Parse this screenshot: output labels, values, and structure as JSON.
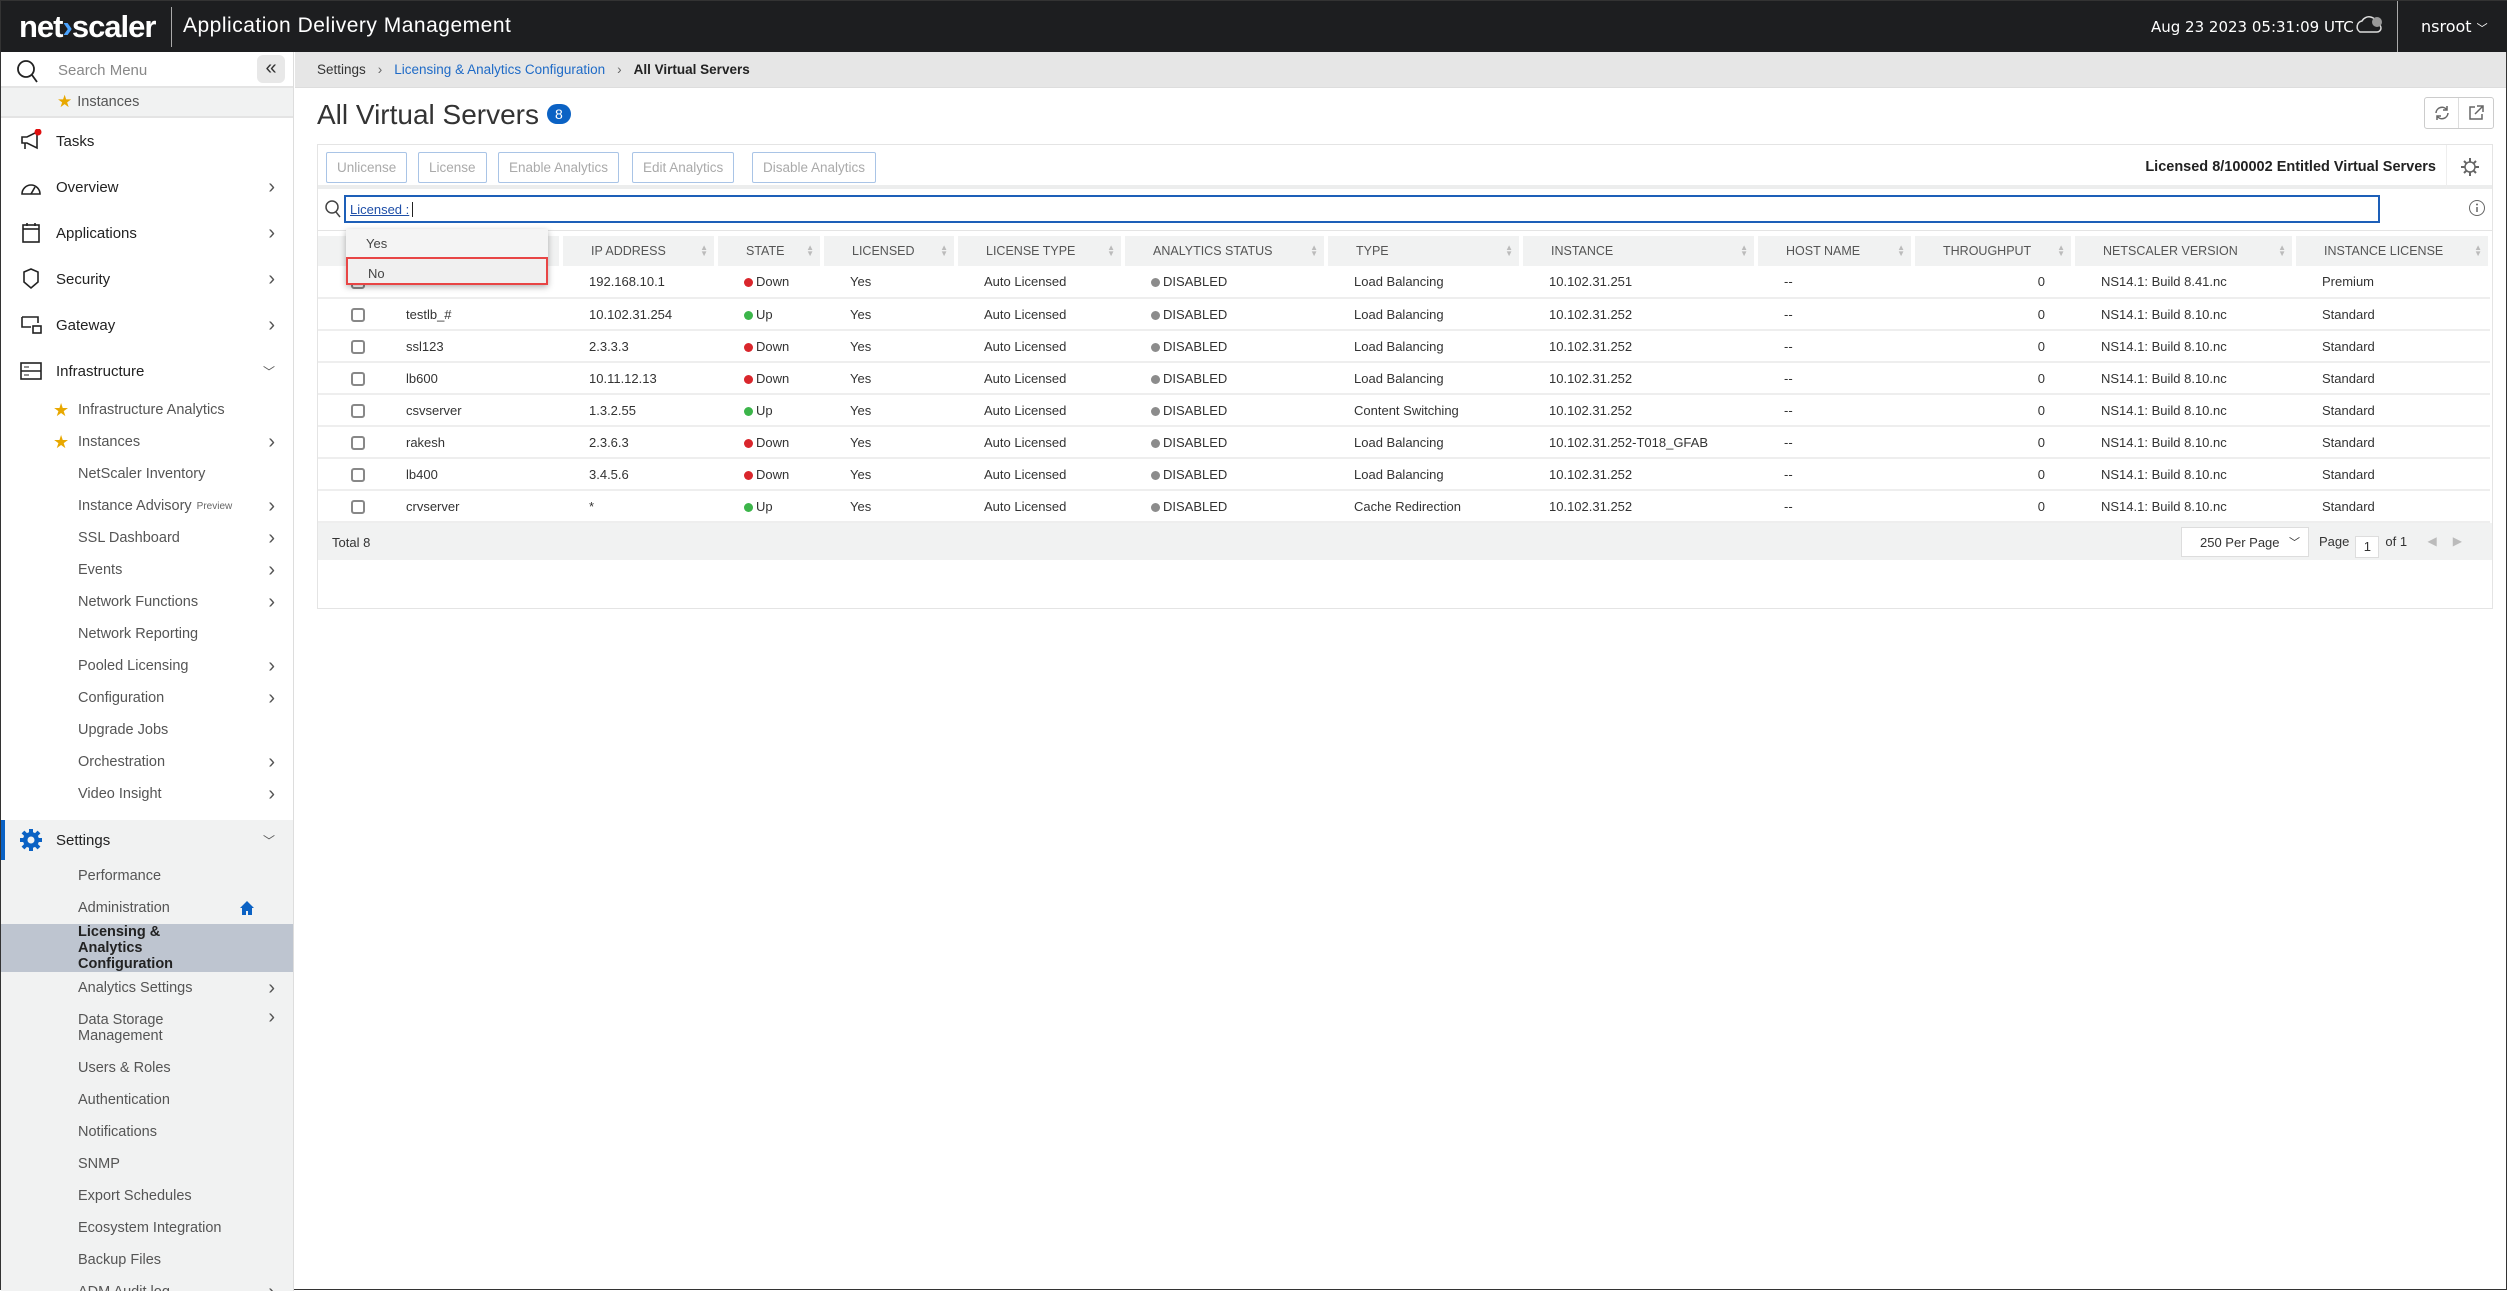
{
  "header": {
    "logo": "netscaler",
    "app_title": "Application Delivery Management",
    "datetime": "Aug 23 2023 05:31:09 UTC",
    "user": "nsroot"
  },
  "sidebar": {
    "search_placeholder": "Search Menu",
    "pinned": "Instances",
    "top_items": [
      {
        "label": "Tasks",
        "icon": "megaphone-icon"
      },
      {
        "label": "Overview",
        "icon": "gauge-icon",
        "chevron": true
      },
      {
        "label": "Applications",
        "icon": "calendar-icon",
        "chevron": true
      },
      {
        "label": "Security",
        "icon": "shield-icon",
        "chevron": true
      },
      {
        "label": "Gateway",
        "icon": "gateway-lock-icon",
        "chevron": true
      },
      {
        "label": "Infrastructure",
        "icon": "server-rack-icon",
        "expanded": true
      }
    ],
    "infra_items": [
      {
        "label": "Infrastructure Analytics",
        "star": true
      },
      {
        "label": "Instances",
        "star": true,
        "chevron": true
      },
      {
        "label": "NetScaler Inventory"
      },
      {
        "label": "Instance Advisory",
        "sup": "Preview",
        "chevron": true
      },
      {
        "label": "SSL Dashboard",
        "chevron": true
      },
      {
        "label": "Events",
        "chevron": true
      },
      {
        "label": "Network Functions",
        "chevron": true
      },
      {
        "label": "Network Reporting"
      },
      {
        "label": "Pooled Licensing",
        "chevron": true
      },
      {
        "label": "Configuration",
        "chevron": true
      },
      {
        "label": "Upgrade Jobs"
      },
      {
        "label": "Orchestration",
        "chevron": true
      },
      {
        "label": "Video Insight",
        "chevron": true
      }
    ],
    "settings": {
      "label": "Settings",
      "items": [
        {
          "label": "Performance"
        },
        {
          "label": "Administration",
          "home": true
        },
        {
          "label": "Licensing & Analytics Configuration",
          "active": true
        },
        {
          "label": "Analytics Settings",
          "chevron": true
        },
        {
          "label": "Data Storage Management",
          "chevron": true,
          "tall": true
        },
        {
          "label": "Users & Roles"
        },
        {
          "label": "Authentication"
        },
        {
          "label": "Notifications"
        },
        {
          "label": "SNMP"
        },
        {
          "label": "Export Schedules"
        },
        {
          "label": "Ecosystem Integration"
        },
        {
          "label": "Backup Files"
        },
        {
          "label": "ADM Audit log",
          "chevron": true
        }
      ]
    }
  },
  "breadcrumb": [
    "Settings",
    "Licensing & Analytics Configuration",
    "All Virtual Servers"
  ],
  "page": {
    "title": "All Virtual Servers",
    "count": "8"
  },
  "toolbar": {
    "buttons": [
      "Unlicense",
      "License",
      "Enable Analytics",
      "Edit Analytics",
      "Disable Analytics"
    ],
    "license_info": "Licensed 8/100002 Entitled Virtual Servers"
  },
  "search": {
    "value": "Licensed :",
    "dropdown": [
      "Yes",
      "No"
    ],
    "selected": "No"
  },
  "table": {
    "columns": [
      "",
      "IP ADDRESS",
      "STATE",
      "LICENSED",
      "LICENSE TYPE",
      "ANALYTICS STATUS",
      "TYPE",
      "INSTANCE",
      "HOST NAME",
      "THROUGHPUT",
      "NETSCALER VERSION",
      "INSTANCE LICENSE"
    ],
    "rows": [
      [
        "",
        "192.168.10.1",
        "Down",
        "Yes",
        "Auto Licensed",
        "DISABLED",
        "Load Balancing",
        "10.102.31.251",
        "--",
        "0",
        "NS14.1: Build 8.41.nc",
        "Premium"
      ],
      [
        "testlb_#",
        "10.102.31.254",
        "Up",
        "Yes",
        "Auto Licensed",
        "DISABLED",
        "Load Balancing",
        "10.102.31.252",
        "--",
        "0",
        "NS14.1: Build 8.10.nc",
        "Standard"
      ],
      [
        "ssl123",
        "2.3.3.3",
        "Down",
        "Yes",
        "Auto Licensed",
        "DISABLED",
        "Load Balancing",
        "10.102.31.252",
        "--",
        "0",
        "NS14.1: Build 8.10.nc",
        "Standard"
      ],
      [
        "lb600",
        "10.11.12.13",
        "Down",
        "Yes",
        "Auto Licensed",
        "DISABLED",
        "Load Balancing",
        "10.102.31.252",
        "--",
        "0",
        "NS14.1: Build 8.10.nc",
        "Standard"
      ],
      [
        "csvserver",
        "1.3.2.55",
        "Up",
        "Yes",
        "Auto Licensed",
        "DISABLED",
        "Content Switching",
        "10.102.31.252",
        "--",
        "0",
        "NS14.1: Build 8.10.nc",
        "Standard"
      ],
      [
        "rakesh",
        "2.3.6.3",
        "Down",
        "Yes",
        "Auto Licensed",
        "DISABLED",
        "Load Balancing",
        "10.102.31.252-T018_GFAB",
        "--",
        "0",
        "NS14.1: Build 8.10.nc",
        "Standard"
      ],
      [
        "lb400",
        "3.4.5.6",
        "Down",
        "Yes",
        "Auto Licensed",
        "DISABLED",
        "Load Balancing",
        "10.102.31.252",
        "--",
        "0",
        "NS14.1: Build 8.10.nc",
        "Standard"
      ],
      [
        "crvserver",
        "*",
        "Up",
        "Yes",
        "Auto Licensed",
        "DISABLED",
        "Cache Redirection",
        "10.102.31.252",
        "--",
        "0",
        "NS14.1: Build 8.10.nc",
        "Standard"
      ]
    ]
  },
  "footer": {
    "total": "Total 8",
    "per_page": "250 Per Page",
    "page_label": "Page",
    "page": "1",
    "of": "of 1"
  },
  "colors": {
    "up": "#3cb54a",
    "down": "#d9262c",
    "disabled": "#8c8c8c",
    "accent": "#0b62c4",
    "highlight": "#e84545"
  }
}
